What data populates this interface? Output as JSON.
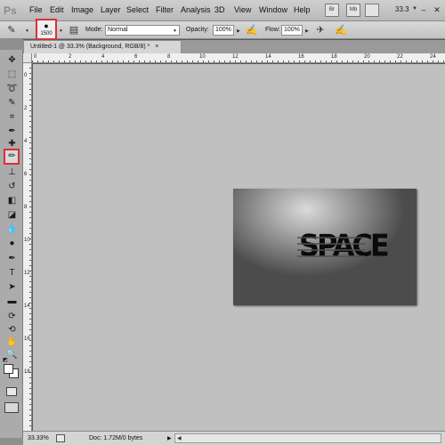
{
  "app": {
    "logo": "Ps"
  },
  "menu": [
    "File",
    "Edit",
    "Image",
    "Layer",
    "Select",
    "Filter",
    "Analysis",
    "3D",
    "View",
    "Window",
    "Help"
  ],
  "menubar_icons": {
    "bridge": "Br",
    "mini_bridge": "Mb"
  },
  "zoom_readout": "33.3",
  "options": {
    "brush_size": "1500",
    "mode_label": "Mode:",
    "mode_value": "Normal",
    "opacity_label": "Opacity:",
    "opacity_value": "100%",
    "flow_label": "Flow:",
    "flow_value": "100%"
  },
  "document": {
    "tab_title": "Untitled-1 @ 33.3% (Background, RGB/8) *",
    "tab_close": "×",
    "canvas_text": "SPACE"
  },
  "rulers": {
    "top": [
      "0",
      "2",
      "4",
      "6",
      "8",
      "10",
      "12",
      "14",
      "16",
      "18",
      "20",
      "22",
      "24"
    ],
    "left": [
      "0",
      "2",
      "4",
      "6",
      "8",
      "10",
      "12",
      "14",
      "16",
      "18"
    ]
  },
  "status": {
    "zoom": "33.33%",
    "doc_size": "Doc: 1.72M/0 bytes"
  },
  "colors": {
    "highlight": "#d9303a",
    "workspace": "#c0c0c0",
    "foreground": "#ffffff",
    "background": "#ffffff"
  },
  "tools": [
    "move-tool-icon",
    "marquee-tool-icon",
    "lasso-tool-icon",
    "quick-select-tool-icon",
    "crop-tool-icon",
    "eyedropper-tool-icon",
    "spot-healing-tool-icon",
    "brush-tool-icon",
    "clone-stamp-tool-icon",
    "history-brush-tool-icon",
    "eraser-tool-icon",
    "paint-bucket-tool-icon",
    "blur-tool-icon",
    "dodge-tool-icon",
    "pen-tool-icon",
    "type-tool-icon",
    "path-select-tool-icon",
    "shape-tool-icon",
    "3d-rotate-tool-icon",
    "3d-orbit-tool-icon",
    "hand-tool-icon",
    "zoom-tool-icon"
  ]
}
